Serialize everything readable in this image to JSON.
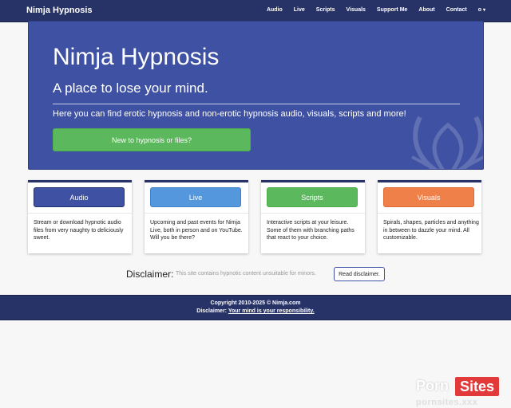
{
  "navbar": {
    "brand": "Nimja Hypnosis",
    "links": [
      "Audio",
      "Live",
      "Scripts",
      "Visuals",
      "Support Me",
      "About",
      "Contact"
    ],
    "user_menu": "o"
  },
  "hero": {
    "title": "Nimja Hypnosis",
    "tagline": "A place to lose your mind.",
    "description": "Here you can find erotic hypnosis and non-erotic hypnosis audio, visuals, scripts and more!",
    "cta_label": "New to hypnosis or files?",
    "cta_color": "#5cb85c",
    "background_color": "#3f51a3"
  },
  "cards": [
    {
      "label": "Audio",
      "color": "#3f51a3",
      "text": "Stream or download hypnotic audio files from very naughty to deliciously sweet."
    },
    {
      "label": "Live",
      "color": "#5497dc",
      "text": "Upcoming and past events for Nimja Live, both in person and on YouTube. Will you be there?"
    },
    {
      "label": "Scripts",
      "color": "#5cb85c",
      "text": "Interactive scripts at your leisure. Some of them with branching paths that react to your choice."
    },
    {
      "label": "Visuals",
      "color": "#f0804a",
      "text": "Spirals, shapes, particles and anything in between to dazzle your mind. All customizable."
    }
  ],
  "disclaimer": {
    "label": "Disclaimer:",
    "text": "This site contains hypnotic content unsuitable for minors.",
    "button_label": "Read disclaimer."
  },
  "footer": {
    "copyright": "Copyright 2010-2025 © Nimja.com",
    "disclaimer_prefix": "Disclaimer:",
    "disclaimer_link": "Your mind is your responsibility."
  },
  "watermark": {
    "porn": "Porn",
    "sites": "Sites",
    "domain": "pornsites.xxx"
  }
}
